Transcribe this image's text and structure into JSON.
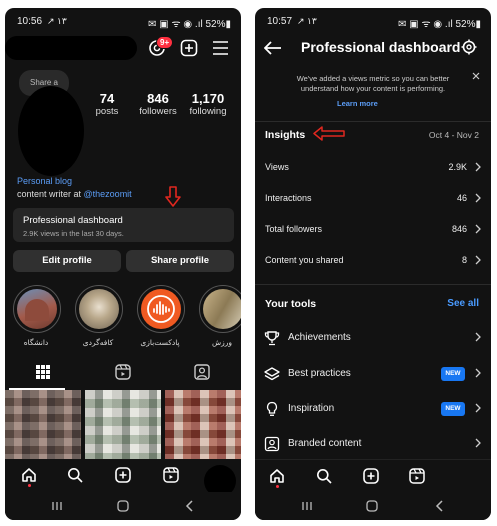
{
  "left": {
    "status": {
      "time": "10:56",
      "time_extra": "↗ ۱۳",
      "right_icons": "✉ ▣ ᯤ ◉ .ıl 52%▮"
    },
    "notification_count": "9+",
    "share_bubble": "Share a",
    "stats": [
      {
        "value": "74",
        "label": "posts"
      },
      {
        "value": "846",
        "label": "followers"
      },
      {
        "value": "1,170",
        "label": "following"
      }
    ],
    "bio_category": "Personal blog",
    "bio_text": "content writer at ",
    "bio_link": "@thezoomit",
    "dashboard": {
      "title": "Professional dashboard",
      "subtitle": "2.9K views in the last 30 days."
    },
    "edit_profile": "Edit profile",
    "share_profile": "Share profile",
    "highlights": [
      {
        "label": "دانشگاه"
      },
      {
        "label": "کافه‌گردی"
      },
      {
        "label": "پادکست‌بازی"
      },
      {
        "label": "ورزش"
      }
    ],
    "colors": {
      "accent_blue": "#5b9cf5",
      "annotation_red": "#e0271f",
      "badge_red": "#ff3040"
    }
  },
  "right": {
    "status": {
      "time": "10:57",
      "time_extra": "↗ ۱۳",
      "right_icons": "✉ ▣ ᯤ ◉ .ıl 52%▮"
    },
    "title": "Professional dashboard",
    "notice": "We've added a views metric so you can better understand how your content is performing.",
    "notice_link": "Learn more",
    "insights_title": "Insights",
    "date_range": "Oct 4 - Nov 2",
    "insights": [
      {
        "label": "Views",
        "value": "2.9K"
      },
      {
        "label": "Interactions",
        "value": "46"
      },
      {
        "label": "Total followers",
        "value": "846"
      },
      {
        "label": "Content you shared",
        "value": "8"
      }
    ],
    "tools_title": "Your tools",
    "see_all": "See all",
    "tools": [
      {
        "label": "Achievements",
        "icon": "trophy-icon",
        "new": ""
      },
      {
        "label": "Best practices",
        "icon": "layers-icon",
        "new": "NEW"
      },
      {
        "label": "Inspiration",
        "icon": "lightbulb-icon",
        "new": "NEW"
      },
      {
        "label": "Branded content",
        "icon": "branded-content-icon",
        "new": ""
      }
    ],
    "colors": {
      "link_blue": "#4a9bff",
      "new_badge": "#1877f2"
    }
  }
}
